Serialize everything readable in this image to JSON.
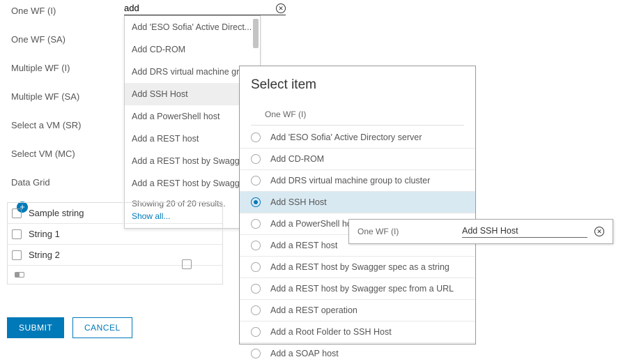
{
  "sidebar": {
    "items": [
      {
        "label": "One WF (I)"
      },
      {
        "label": "One WF (SA)"
      },
      {
        "label": "Multiple WF (I)"
      },
      {
        "label": "Multiple WF (SA)"
      },
      {
        "label": "Select a VM (SR)"
      },
      {
        "label": "Select VM (MC)"
      },
      {
        "label": "Data Grid"
      }
    ]
  },
  "search": {
    "value": "add"
  },
  "dropdown": {
    "items": [
      "Add 'ESO Sofia' Active Direct...",
      "Add CD-ROM",
      "Add DRS virtual machine gro...",
      "Add SSH Host",
      "Add a PowerShell host",
      "Add a REST host",
      "Add a REST host by Swagger",
      "Add a REST host by Swagger"
    ],
    "hover_index": 3,
    "results_text": "Showing 20 of 20 results.",
    "show_all": "Show all..."
  },
  "grid": {
    "header": "Sample string",
    "rows": [
      "String 1",
      "String 2"
    ]
  },
  "buttons": {
    "submit": "SUBMIT",
    "cancel": "CANCEL"
  },
  "dialog": {
    "title": "Select item",
    "breadcrumb": "One WF (I)",
    "selected_index": 3,
    "options": [
      "Add 'ESO Sofia' Active Directory server",
      "Add CD-ROM",
      "Add DRS virtual machine group to cluster",
      "Add SSH Host",
      "Add a PowerShell host",
      "Add a REST host",
      "Add a REST host by Swagger spec as a string",
      "Add a REST host by Swagger spec from a URL",
      "Add a REST operation",
      "Add a Root Folder to SSH Host",
      "Add a SOAP host"
    ]
  },
  "pill": {
    "label": "One WF (I)",
    "value": "Add SSH Host"
  }
}
